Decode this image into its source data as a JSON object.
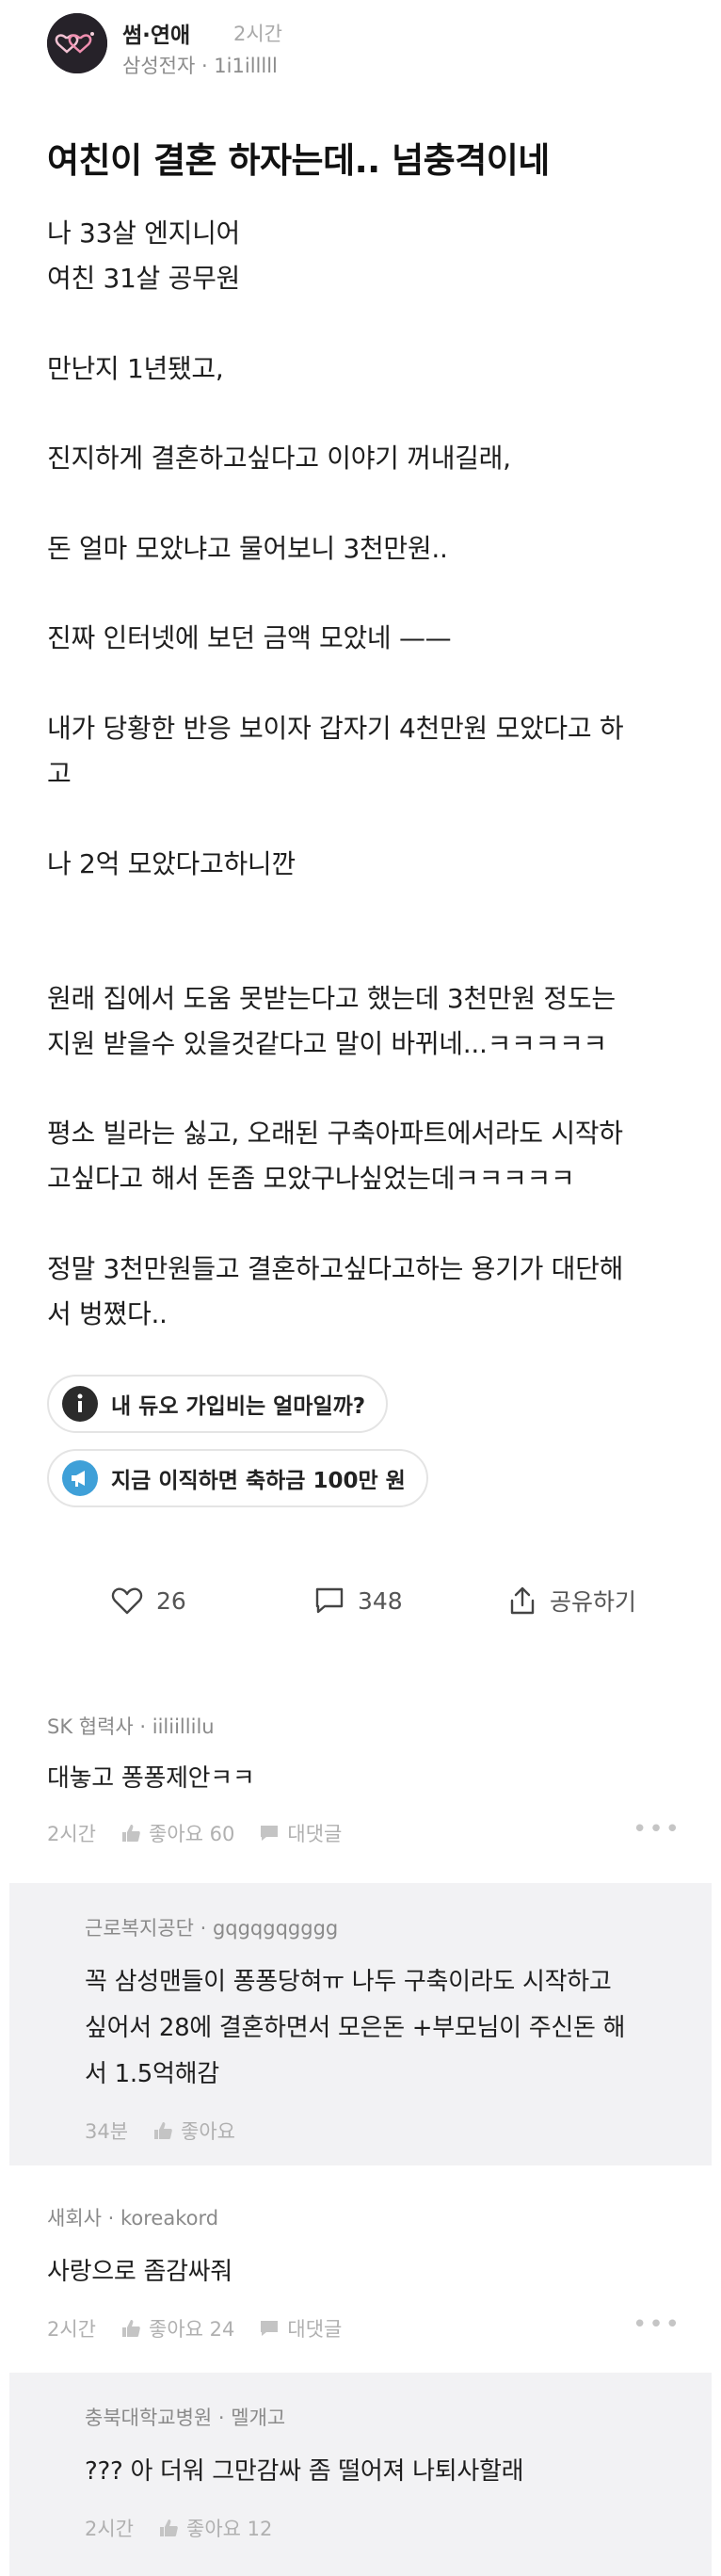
{
  "post": {
    "channel": "썸·연애",
    "time": "2시간",
    "author": "삼성전자 · 1i1illlll",
    "title": "여친이 결혼 하자는데.. 넘충격이네",
    "lines": [
      "나 33살 엔지니어",
      "여친 31살 공무원",
      "만난지 1년됐고,",
      "진지하게 결혼하고싶다고 이야기 꺼내길래,",
      "돈 얼마 모았냐고 물어보니 3천만원..",
      "진짜 인터넷에 보던 금액 모았네 ——",
      "내가 당황한 반응 보이자 갑자기 4천만원 모았다고 하",
      "고",
      "나 2억 모았다고하니깐",
      "원래 집에서 도움 못받는다고 했는데 3천만원 정도는",
      "지원 받을수 있을것같다고 말이 바뀌네...ㅋㅋㅋㅋㅋ",
      "평소 빌라는 싫고, 오래된 구축아파트에서라도 시작하",
      "고싶다고 해서 돈좀 모았구나싶었는데ㅋㅋㅋㅋㅋ",
      "정말 3천만원들고 결혼하고싶다고하는 용기가 대단해",
      "서 벙쪘다.."
    ]
  },
  "promos": [
    {
      "label": "내 듀오 가입비는 얼마일까?",
      "icon": "info-icon"
    },
    {
      "label": "지금 이직하면 축하금 100만 원",
      "icon": "megaphone-icon"
    }
  ],
  "actions": {
    "likes": "26",
    "comments": "348",
    "share": "공유하기"
  },
  "comments": [
    {
      "dept": "SK 협력사 · iiliillilu",
      "text": [
        "대놓고 퐁퐁제안ㅋㅋ"
      ],
      "time": "2시간",
      "like": "좋아요 60",
      "reply": "대댓글",
      "is_reply": false
    },
    {
      "dept": "근로복지공단 · gqgqgqgggg",
      "text": [
        "꼭 삼성맨들이 퐁퐁당혀ㅠ 나두 구축이라도 시작하고",
        "싶어서 28에 결혼하면서 모은돈 +부모님이 주신돈 해",
        "서 1.5억해감"
      ],
      "time": "34분",
      "like": "좋아요",
      "is_reply": true
    },
    {
      "dept": "새회사 · koreakord",
      "text": [
        "사랑으로 좀감싸줘"
      ],
      "time": "2시간",
      "like": "좋아요 24",
      "reply": "대댓글",
      "is_reply": false
    },
    {
      "dept": "충북대학교병원 · 멜개고",
      "text": [
        "??? 아 더워 그만감싸 좀 떨어져 나퇴사할래"
      ],
      "time": "2시간",
      "like": "좋아요 12",
      "is_reply": true
    }
  ]
}
